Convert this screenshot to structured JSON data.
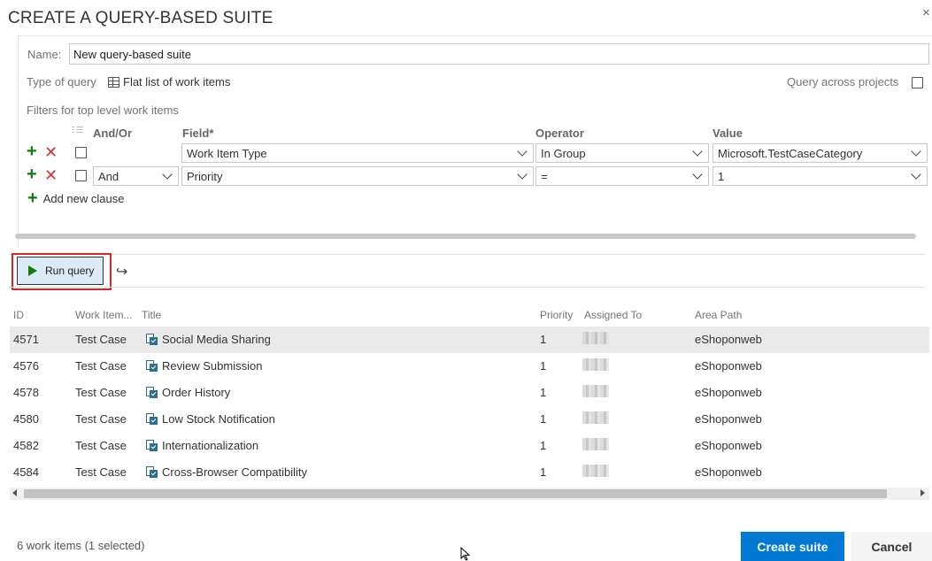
{
  "dialog": {
    "title": "CREATE A QUERY-BASED SUITE",
    "close_glyph": "×"
  },
  "form": {
    "name_label": "Name:",
    "name_value": "New query-based suite",
    "type_label": "Type of query",
    "type_value": "Flat list of work items",
    "across_projects_label": "Query across projects",
    "across_projects_checked": false,
    "filters_label": "Filters for top level work items"
  },
  "clauses": {
    "headers": {
      "andor": "And/Or",
      "field": "Field*",
      "operator": "Operator",
      "value": "Value"
    },
    "rows": [
      {
        "andor": "",
        "field": "Work Item Type",
        "operator": "In Group",
        "value": "Microsoft.TestCaseCategory"
      },
      {
        "andor": "And",
        "field": "Priority",
        "operator": "=",
        "value": "1"
      }
    ],
    "add_clause_label": "Add new clause"
  },
  "toolbar": {
    "run_query_label": "Run query"
  },
  "results": {
    "headers": {
      "id": "ID",
      "type": "Work Item...",
      "title": "Title",
      "priority": "Priority",
      "assigned_to": "Assigned To",
      "area_path": "Area Path"
    },
    "rows": [
      {
        "id": "4571",
        "type": "Test Case",
        "title": "Social Media Sharing",
        "priority": "1",
        "area_path": "eShoponweb",
        "selected": true
      },
      {
        "id": "4576",
        "type": "Test Case",
        "title": "Review Submission",
        "priority": "1",
        "area_path": "eShoponweb",
        "selected": false
      },
      {
        "id": "4578",
        "type": "Test Case",
        "title": "Order History",
        "priority": "1",
        "area_path": "eShoponweb",
        "selected": false
      },
      {
        "id": "4580",
        "type": "Test Case",
        "title": "Low Stock Notification",
        "priority": "1",
        "area_path": "eShoponweb",
        "selected": false
      },
      {
        "id": "4582",
        "type": "Test Case",
        "title": "Internationalization",
        "priority": "1",
        "area_path": "eShoponweb",
        "selected": false
      },
      {
        "id": "4584",
        "type": "Test Case",
        "title": "Cross-Browser Compatibility",
        "priority": "1",
        "area_path": "eShoponweb",
        "selected": false
      }
    ]
  },
  "footer": {
    "status": "6 work items (1 selected)",
    "create_label": "Create suite",
    "cancel_label": "Cancel"
  },
  "colors": {
    "primary": "#0078d4",
    "add_green": "#107c10",
    "delete_red": "#d13438",
    "highlight_red": "#d42727"
  },
  "icons": {
    "close": "close-icon",
    "table": "table-icon",
    "add": "plus-icon",
    "delete": "x-icon",
    "play": "play-icon",
    "redo": "redo-icon",
    "test_case": "test-case-icon",
    "cursor": "mouse-cursor-icon"
  }
}
